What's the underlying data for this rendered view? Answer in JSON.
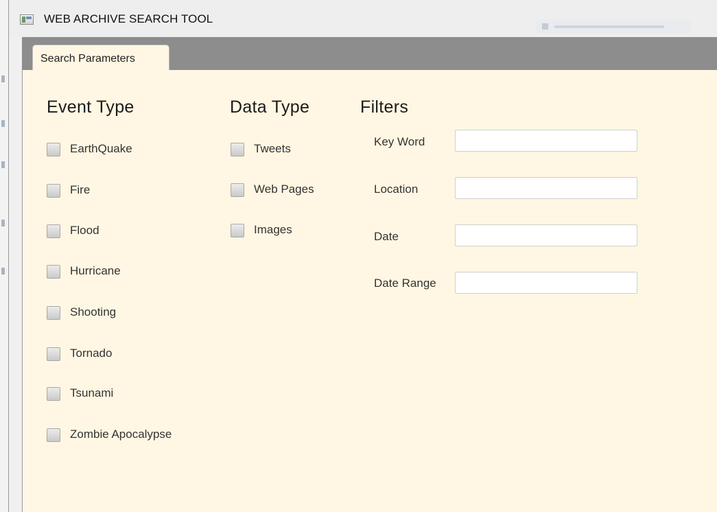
{
  "window": {
    "title": "WEB ARCHIVE SEARCH TOOL"
  },
  "tabs": [
    {
      "label": "Search Parameters",
      "active": true
    }
  ],
  "event_type": {
    "title": "Event Type",
    "items": [
      {
        "label": "EarthQuake",
        "checked": false
      },
      {
        "label": "Fire",
        "checked": false
      },
      {
        "label": "Flood",
        "checked": false
      },
      {
        "label": "Hurricane",
        "checked": false
      },
      {
        "label": "Shooting",
        "checked": false
      },
      {
        "label": "Tornado",
        "checked": false
      },
      {
        "label": "Tsunami",
        "checked": false
      },
      {
        "label": "Zombie Apocalypse",
        "checked": false
      }
    ]
  },
  "data_type": {
    "title": "Data Type",
    "items": [
      {
        "label": "Tweets",
        "checked": false
      },
      {
        "label": "Web Pages",
        "checked": false
      },
      {
        "label": "Images",
        "checked": false
      }
    ]
  },
  "filters": {
    "title": "Filters",
    "fields": [
      {
        "label": "Key Word",
        "value": "",
        "placeholder": ""
      },
      {
        "label": "Location",
        "value": "",
        "placeholder": ""
      },
      {
        "label": "Date",
        "value": "",
        "placeholder": ""
      },
      {
        "label": "Date Range",
        "value": "",
        "placeholder": ""
      }
    ]
  },
  "colors": {
    "content_background": "#fff7e3",
    "tab_bar": "#8d8d8d",
    "checkbox": "#d6d6d6"
  }
}
